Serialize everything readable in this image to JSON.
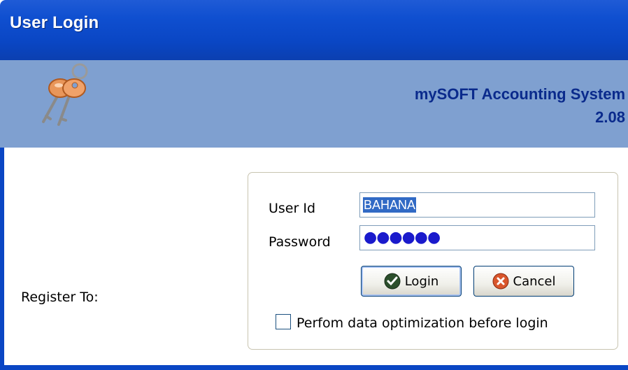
{
  "window": {
    "title": "User Login"
  },
  "banner": {
    "app_name": "mySOFT Accounting System",
    "version": "2.08",
    "logo_icon": "keys-icon"
  },
  "register": {
    "label": "Register To:"
  },
  "form": {
    "user_id_label": "User Id",
    "user_id_value": "BAHANA",
    "password_label": "Password",
    "password_mask": "●●●●●●",
    "login_label": "Login",
    "login_icon": "checkmark-icon",
    "cancel_label": "Cancel",
    "cancel_icon": "close-icon",
    "optimize_label": "Perfom data optimization before login",
    "optimize_checked": false
  },
  "colors": {
    "titlebar": "#0a46c4",
    "banner": "#7fa0d0",
    "accent_text": "#0a2a8c"
  }
}
